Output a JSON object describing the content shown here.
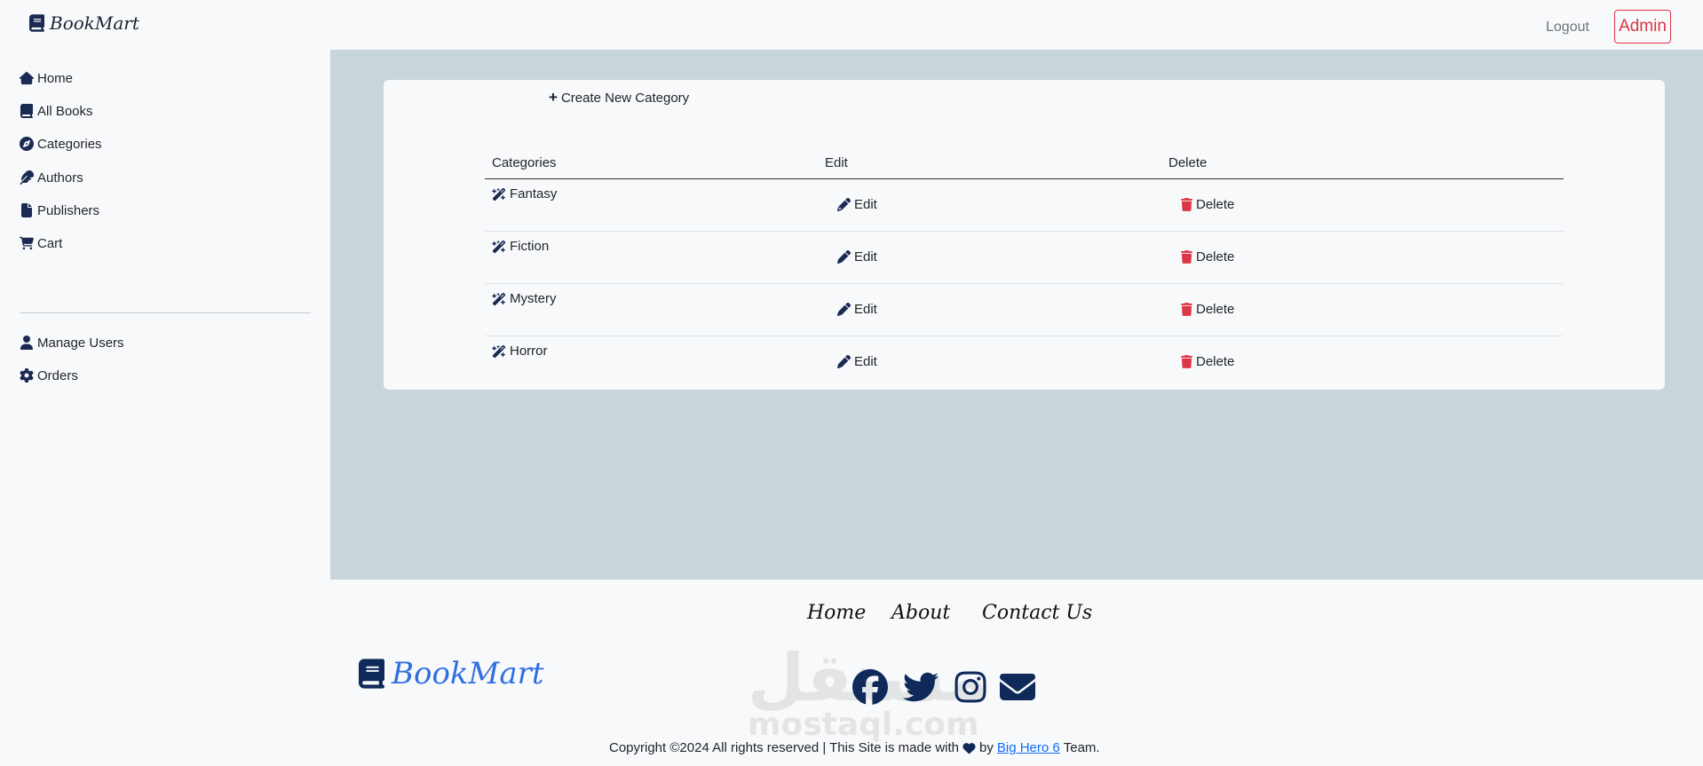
{
  "navbar": {
    "brand": "BookMart",
    "logout": "Logout",
    "admin": "Admin"
  },
  "sidebar": {
    "items": [
      {
        "label": "Home",
        "icon": "home-icon"
      },
      {
        "label": "All Books",
        "icon": "book-icon"
      },
      {
        "label": "Categories",
        "icon": "compass-icon"
      },
      {
        "label": "Authors",
        "icon": "feather-icon"
      },
      {
        "label": "Publishers",
        "icon": "file-icon"
      },
      {
        "label": "Cart",
        "icon": "cart-icon"
      }
    ],
    "admin_items": [
      {
        "label": "Manage Users",
        "icon": "user-icon"
      },
      {
        "label": "Orders",
        "icon": "gear-icon"
      }
    ]
  },
  "main": {
    "create_label": "Create New Category",
    "table": {
      "headers": [
        "Categories",
        "Edit",
        "Delete"
      ],
      "rows": [
        {
          "category": "Fantasy",
          "edit": "Edit",
          "delete": "Delete"
        },
        {
          "category": "Fiction",
          "edit": "Edit",
          "delete": "Delete"
        },
        {
          "category": "Mystery",
          "edit": "Edit",
          "delete": "Delete"
        },
        {
          "category": "Horror",
          "edit": "Edit",
          "delete": "Delete"
        }
      ]
    }
  },
  "footer": {
    "nav": [
      "Home",
      "About",
      "Contact Us"
    ],
    "brand": "BookMart",
    "social": [
      "facebook-icon",
      "twitter-icon",
      "instagram-icon",
      "envelope-icon"
    ],
    "copyright_prefix": "Copyright ©2024 All rights reserved | This Site is made with",
    "copyright_by": "by",
    "team_link": "Big Hero 6",
    "copyright_suffix": "Team.",
    "watermark_ar": "مستقل",
    "watermark_en": "mostaql.com"
  },
  "colors": {
    "accent_red": "#dc3545",
    "navy": "#1a2a52",
    "content_bg": "#c8d5db",
    "footer_brand": "#2f6fe0",
    "link": "#0d6efd"
  }
}
